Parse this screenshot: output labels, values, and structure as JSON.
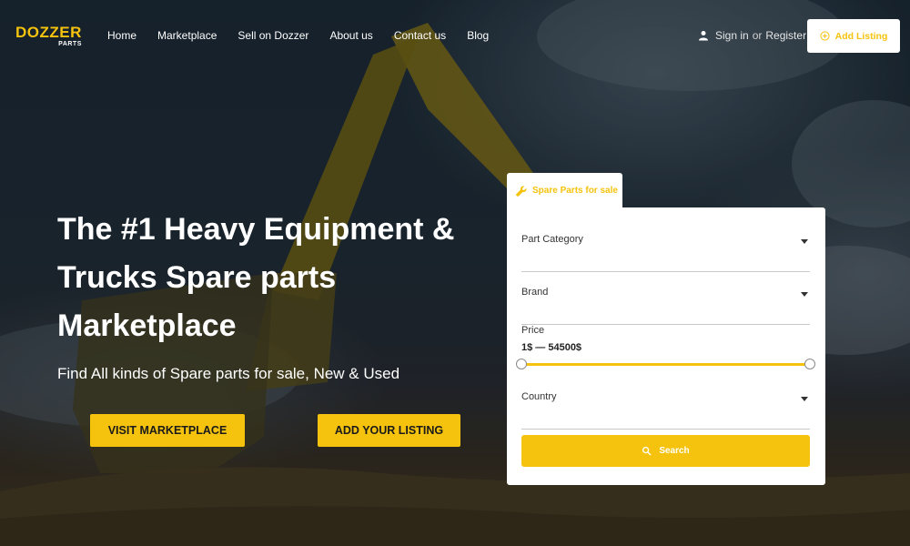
{
  "brand": {
    "name_main": "DOZZER",
    "name_sub": "PARTS",
    "accent_color": "#f5c30e"
  },
  "nav": {
    "items": [
      {
        "label": "Home"
      },
      {
        "label": "Marketplace"
      },
      {
        "label": "Sell on Dozzer"
      },
      {
        "label": "About us"
      },
      {
        "label": "Contact us"
      },
      {
        "label": "Blog"
      }
    ]
  },
  "account": {
    "icon": "user-icon",
    "signin_label": "Sign in",
    "or_label": "or",
    "register_label": "Register"
  },
  "header_cta": {
    "icon": "plus-circle-icon",
    "label": "Add Listing"
  },
  "hero": {
    "title": "The #1 Heavy Equipment & Trucks Spare parts Marketplace",
    "subtitle": "Find All kinds of Spare parts for sale, New & Used",
    "primary_cta": "VISIT MARKETPLACE",
    "secondary_cta": "ADD YOUR LISTING"
  },
  "search_card": {
    "tab_icon": "wrench-icon",
    "tab_label": "Spare Parts for sale",
    "part_category_label": "Part Category",
    "brand_label": "Brand",
    "price_label": "Price",
    "price_range": "1$ — 54500$",
    "price_min": 1,
    "price_max": 54500,
    "country_label": "Country",
    "search_icon": "search-icon",
    "search_label": "Search"
  }
}
